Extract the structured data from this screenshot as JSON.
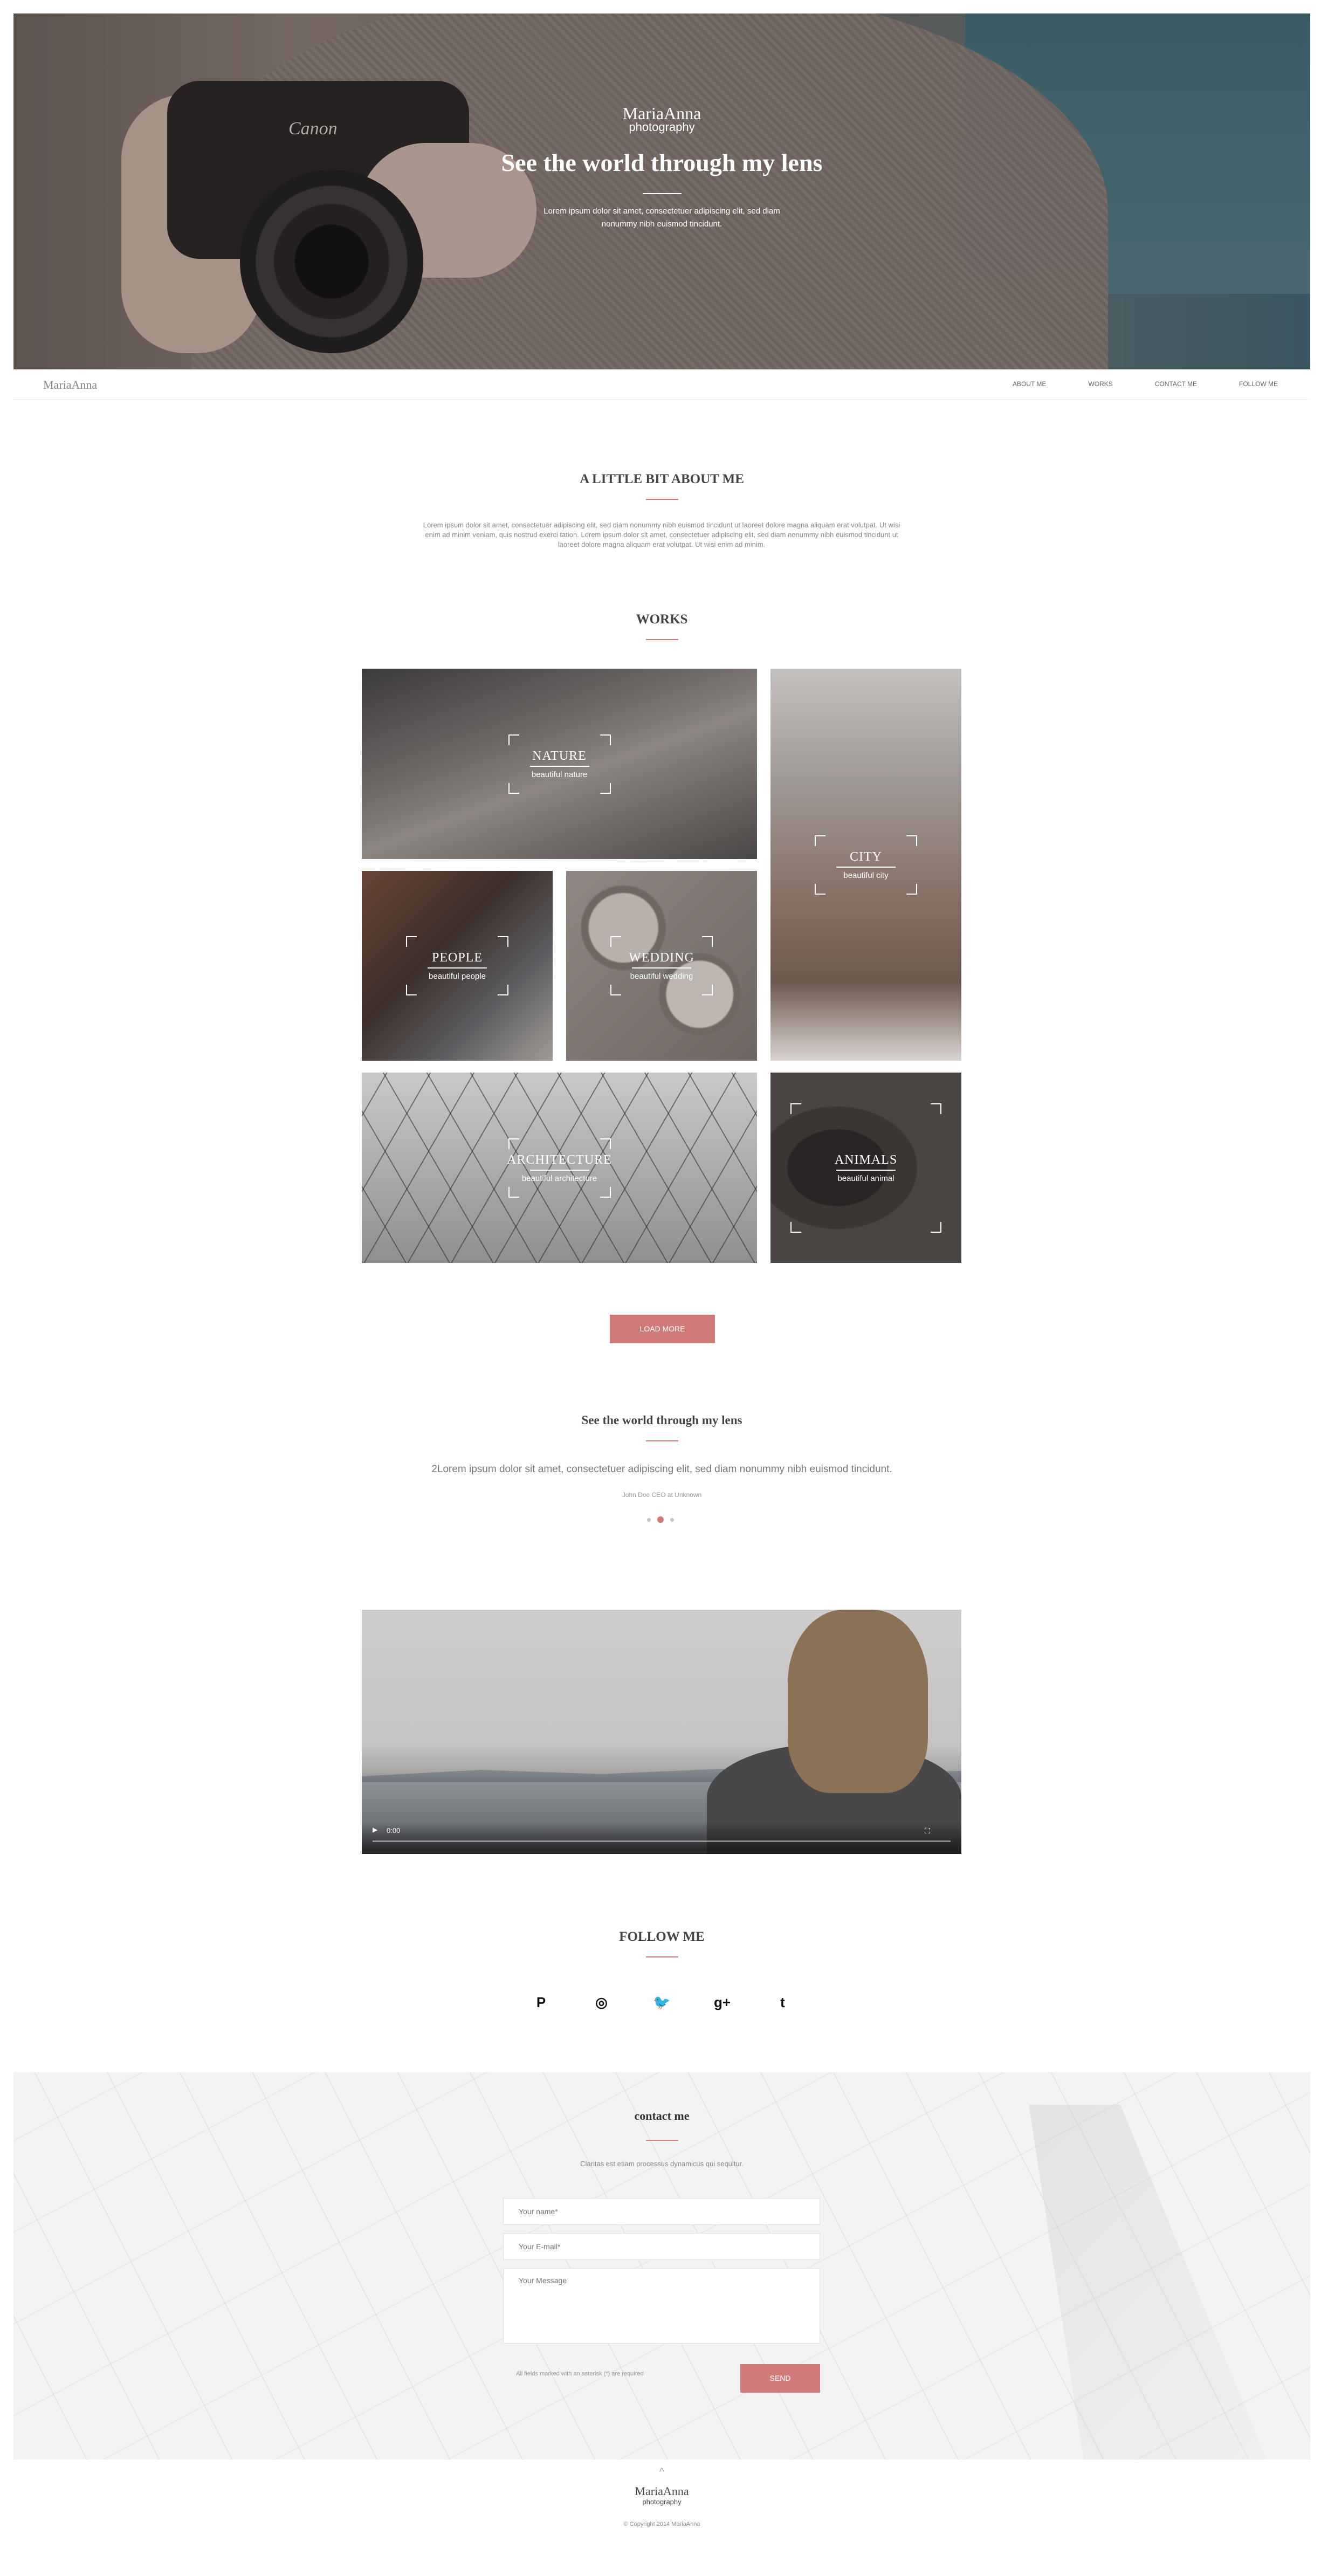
{
  "hero": {
    "logo": "MariaAnna",
    "logo_sub": "photography",
    "title": "See the world through my lens",
    "text": "Lorem ipsum dolor sit amet, consectetuer adipiscing elit, sed diam nonummy nibh euismod tincidunt.",
    "camera_brand": "Canon"
  },
  "nav": {
    "logo": "MariaAnna",
    "items": [
      "ABOUT ME",
      "WORKS",
      "CONTACT ME",
      "FOLLOW ME"
    ]
  },
  "about": {
    "title": "A LITTLE BIT ABOUT ME",
    "text": "Lorem ipsum dolor sit amet, consectetuer adipiscing elit, sed diam nonummy nibh euismod tincidunt ut laoreet dolore magna aliquam erat volutpat. Ut wisi enim ad minim veniam, quis nostrud exerci tation. Lorem ipsum dolor sit amet, consectetuer adipiscing elit, sed diam nonummy nibh euismod tincidunt ut laoreet dolore magna aliquam erat volutpat. Ut wisi enim ad minim."
  },
  "works": {
    "title": "WORKS",
    "tiles": [
      {
        "title": "NATURE",
        "subtitle": "beautiful nature"
      },
      {
        "title": "CITY",
        "subtitle": "beautiful city"
      },
      {
        "title": "PEOPLE",
        "subtitle": "beautiful people"
      },
      {
        "title": "WEDDING",
        "subtitle": "beautiful wedding"
      },
      {
        "title": "ARCHITECTURE",
        "subtitle": "beautiful architecture"
      },
      {
        "title": "ANIMALS",
        "subtitle": "beautiful animal"
      }
    ],
    "load_more": "LOAD MORE"
  },
  "testimonial": {
    "title": "See the world through my lens",
    "quote": "2Lorem ipsum dolor sit amet, consectetuer adipiscing elit, sed diam nonummy nibh euismod tincidunt.",
    "author": "John Doe CEO at Unknown",
    "active_slide": 2,
    "slides": 3
  },
  "video": {
    "time": "0:00",
    "play_icon": "play-icon",
    "fullscreen_icon": "fullscreen-icon"
  },
  "follow": {
    "title": "FOLLOW ME",
    "icons": [
      {
        "name": "pinterest-icon",
        "glyph": "P"
      },
      {
        "name": "instagram-icon",
        "glyph": "◎"
      },
      {
        "name": "twitter-icon",
        "glyph": "🐦"
      },
      {
        "name": "google-plus-icon",
        "glyph": "g+"
      },
      {
        "name": "tumblr-icon",
        "glyph": "t"
      }
    ]
  },
  "contact": {
    "title": "contact me",
    "intro": "Claritas est etiam processus dynamicus qui sequitur.",
    "name_placeholder": "Your name*",
    "email_placeholder": "Your E-mail*",
    "message_placeholder": "Your Message",
    "note": "All fields marked with an asterisk (*) are required",
    "send": "SEND"
  },
  "footer": {
    "up_icon": "^",
    "logo": "MariaAnna",
    "logo_sub": "photography",
    "copyright": "© Copyright 2014 MariaAnna"
  },
  "colors": {
    "accent": "#d17a7a",
    "text": "#555555",
    "muted": "#888888"
  }
}
